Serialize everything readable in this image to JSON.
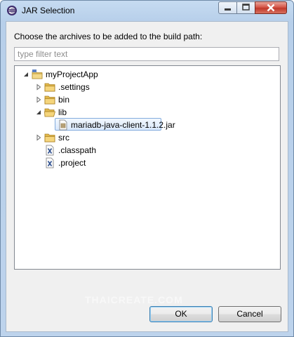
{
  "window": {
    "title": "JAR Selection"
  },
  "dialog": {
    "prompt": "Choose the archives to be added to the build path:",
    "filter_placeholder": "type filter text",
    "filter_value": ""
  },
  "tree": {
    "root": {
      "label": "myProjectApp",
      "expanded": true
    },
    "items": [
      {
        "label": ".settings",
        "type": "folder",
        "expanded": false
      },
      {
        "label": "bin",
        "type": "folder",
        "expanded": false
      },
      {
        "label": "lib",
        "type": "folder",
        "expanded": true
      },
      {
        "label": "mariadb-java-client-1.1.2.jar",
        "type": "jar",
        "selected": true
      },
      {
        "label": "src",
        "type": "folder",
        "expanded": false
      },
      {
        "label": ".classpath",
        "type": "xml-file"
      },
      {
        "label": ".project",
        "type": "xml-file"
      }
    ]
  },
  "buttons": {
    "ok": "OK",
    "cancel": "Cancel"
  },
  "watermark": "THAICREATE.COM",
  "colors": {
    "selection_border": "#84acdd",
    "close_button": "#c0392b",
    "title_gradient": "#c6dbf1"
  }
}
